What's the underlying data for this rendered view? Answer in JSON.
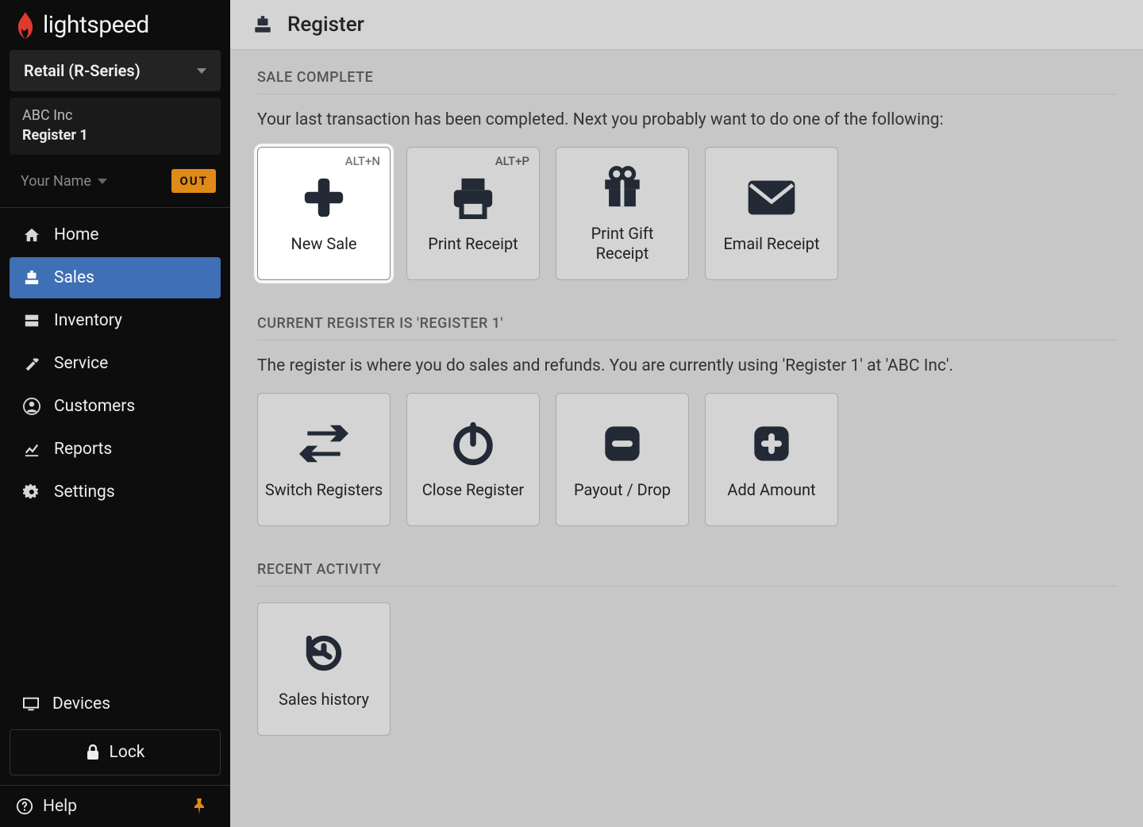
{
  "brand": {
    "name": "lightspeed"
  },
  "product_selector": {
    "label": "Retail (R-Series)"
  },
  "store": {
    "company": "ABC Inc",
    "register": "Register 1"
  },
  "user": {
    "name": "Your Name",
    "status_badge": "OUT"
  },
  "nav": {
    "items": [
      {
        "label": "Home"
      },
      {
        "label": "Sales"
      },
      {
        "label": "Inventory"
      },
      {
        "label": "Service"
      },
      {
        "label": "Customers"
      },
      {
        "label": "Reports"
      },
      {
        "label": "Settings"
      }
    ]
  },
  "devices_label": "Devices",
  "lock_label": "Lock",
  "help_label": "Help",
  "topbar": {
    "title": "Register"
  },
  "sale_complete": {
    "heading": "SALE COMPLETE",
    "message": "Your last transaction has been completed. Next you probably want to do one of the following:",
    "actions": [
      {
        "label": "New Sale",
        "shortcut": "ALT+N"
      },
      {
        "label": "Print Receipt",
        "shortcut": "ALT+P"
      },
      {
        "label": "Print Gift Receipt"
      },
      {
        "label": "Email Receipt"
      }
    ]
  },
  "current_register": {
    "heading": "CURRENT REGISTER IS 'REGISTER 1'",
    "message": "The register is where you do sales and refunds. You are currently using 'Register 1'  at 'ABC Inc'.",
    "actions": [
      {
        "label": "Switch Registers"
      },
      {
        "label": "Close Register"
      },
      {
        "label": "Payout / Drop"
      },
      {
        "label": "Add Amount"
      }
    ]
  },
  "recent_activity": {
    "heading": "RECENT ACTIVITY",
    "actions": [
      {
        "label": "Sales history"
      }
    ]
  }
}
